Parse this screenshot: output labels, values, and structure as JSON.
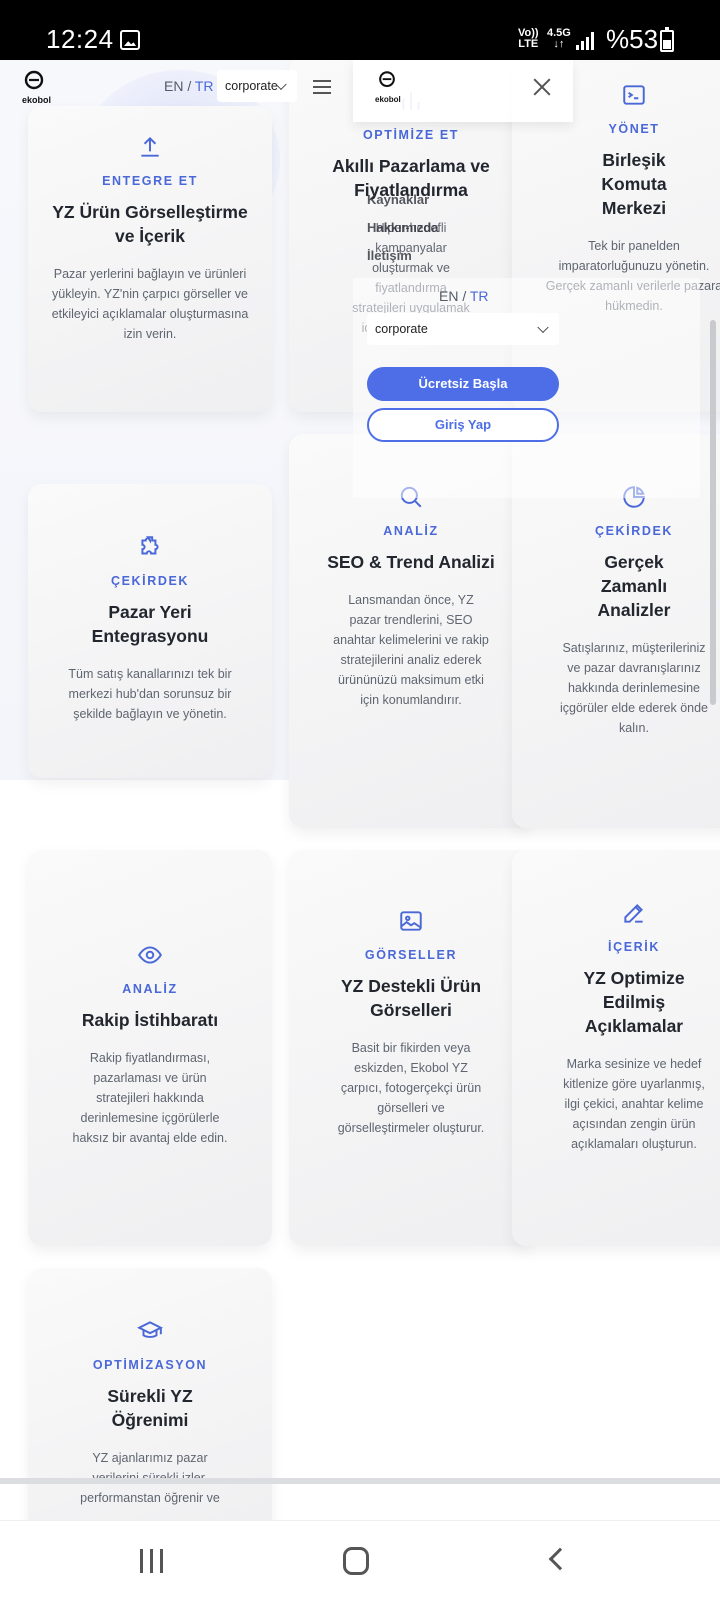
{
  "status_bar": {
    "time": "12:24",
    "volte_top": "Vo))",
    "volte_bottom": "LTE",
    "network_top": "4.5G",
    "network_bottom": "↓↑",
    "battery": "%53"
  },
  "header": {
    "logo_text": "ekobol",
    "lang_en": "EN",
    "lang_sep": "/",
    "lang_tr": "TR",
    "select_value": "corporate"
  },
  "mobile_menu": {
    "logo_text": "ekobol",
    "links": [
      "Kaynaklar",
      "Hakkımızda",
      "İletişim"
    ],
    "lang_en": "EN",
    "lang_sep": "/",
    "lang_tr": "TR",
    "select_value": "corporate",
    "primary_button": "Ücretsiz Başla",
    "secondary_button": "Giriş Yap"
  },
  "cards": [
    {
      "category": "ENTEGRE ET",
      "title": "YZ Ürün Görselleştirme ve İçerik",
      "description": "Pazar yerlerini bağlayın ve ürünleri yükleyin. YZ'nin çarpıcı görseller ve etkileyici açıklamalar oluşturmasına izin verin.",
      "icon": "upload-icon"
    },
    {
      "category": "OPTİMİZE ET",
      "title": "Akıllı Pazarlama ve Fiyatlandırma",
      "description": "Hiper-hedefli kampanyalar oluşturmak ve fiyatlandırma stratejileri uygulamak için YZ'ye bırakın.",
      "icon": "chart-bars-icon"
    },
    {
      "category": "YÖNET",
      "title": "Birleşik Komuta Merkezi",
      "description": "Tek bir panelden imparatorluğunuzu yönetin. Gerçek zamanlı verilerle pazara hükmedin.",
      "icon": "terminal-icon"
    },
    {
      "category": "ÇEKİRDEK",
      "title": "Pazar Yeri Entegrasyonu",
      "description": "Tüm satış kanallarınızı tek bir merkezi hub'dan sorunsuz bir şekilde bağlayın ve yönetin.",
      "icon": "puzzle-icon"
    },
    {
      "category": "ANALİZ",
      "title": "SEO & Trend Analizi",
      "description": "Lansmandan önce, YZ pazar trendlerini, SEO anahtar kelimelerini ve rakip stratejilerini analiz ederek ürününüzü maksimum etki için konumlandırır.",
      "icon": "search-icon"
    },
    {
      "category": "ÇEKİRDEK",
      "title": "Gerçek Zamanlı Analizler",
      "description": "Satışlarınız, müşterileriniz ve pazar davranışlarınız hakkında derinlemesine içgörüler elde ederek önde kalın.",
      "icon": "pie-chart-icon"
    },
    {
      "category": "ANALİZ",
      "title": "Rakip İstihbaratı",
      "description": "Rakip fiyatlandırması, pazarlaması ve ürün stratejileri hakkında derinlemesine içgörülerle haksız bir avantaj elde edin.",
      "icon": "eye-icon"
    },
    {
      "category": "GÖRSELLER",
      "title": "YZ Destekli Ürün Görselleri",
      "description": "Basit bir fikirden veya eskizden, Ekobol YZ çarpıcı, fotogerçekçi ürün görselleri ve görselleştirmeler oluşturur.",
      "icon": "image-icon"
    },
    {
      "category": "İÇERİK",
      "title": "YZ Optimize Edilmiş Açıklamalar",
      "description": "Marka sesinize ve hedef kitlenize göre uyarlanmış, ilgi çekici, anahtar kelime açısından zengin ürün açıklamaları oluşturun.",
      "icon": "edit-icon"
    },
    {
      "category": "OPTİMİZASYON",
      "title": "Sürekli YZ Öğrenimi",
      "description": "YZ ajanlarımız pazar verilerini sürekli izler, performanstan öğrenir ve",
      "icon": "graduation-cap-icon"
    }
  ],
  "colors": {
    "accent": "#4a68d8",
    "button": "#4d6ee6"
  }
}
